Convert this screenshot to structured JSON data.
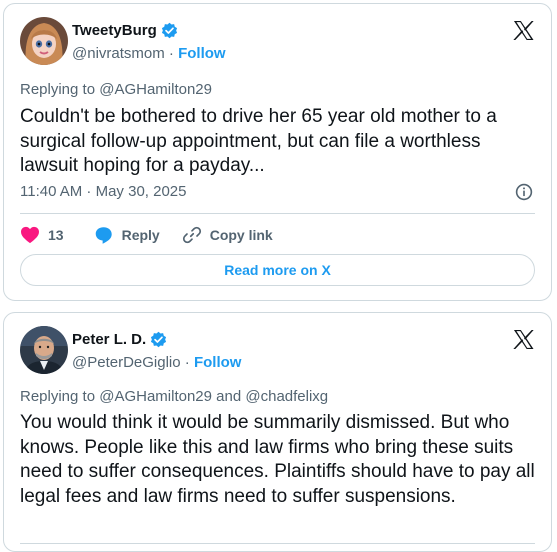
{
  "tweets": [
    {
      "display_name": "TweetyBurg",
      "handle": "@nivratsmom",
      "separator": " · ",
      "follow_label": "Follow",
      "replying_prefix": "Replying to ",
      "replying_to": "@AGHamilton29",
      "text": "Couldn't be bothered to drive her 65 year old mother to a surgical follow-up appointment, but can file a worthless lawsuit hoping for a payday...",
      "timestamp": "11:40 AM · May 30, 2025",
      "likes": "13",
      "reply_label": "Reply",
      "copy_label": "Copy link",
      "read_more_label": "Read more on X",
      "avatar_icon": "cartoon-woman-avatar"
    },
    {
      "display_name": "Peter L. D.",
      "handle": "@PeterDeGiglio",
      "separator": " · ",
      "follow_label": "Follow",
      "replying_prefix": "Replying to ",
      "replying_to": "@AGHamilton29",
      "replying_and": " and ",
      "replying_to_2": "@chadfelixg",
      "text": "You would think it would be summarily dismissed. But who knows. People like this and law firms who bring these suits need to suffer consequences.  Plaintiffs should have to pay all legal fees and law firms need to suffer suspensions.",
      "avatar_icon": "man-portrait-avatar"
    }
  ],
  "colors": {
    "accent": "#1d9bf0",
    "like": "#f91880",
    "muted": "#536471",
    "text": "#0f1419",
    "border": "#cfd9de"
  },
  "icons": [
    "x-logo-icon",
    "verified-badge-icon",
    "info-icon",
    "heart-icon",
    "reply-bubble-icon",
    "link-icon"
  ]
}
